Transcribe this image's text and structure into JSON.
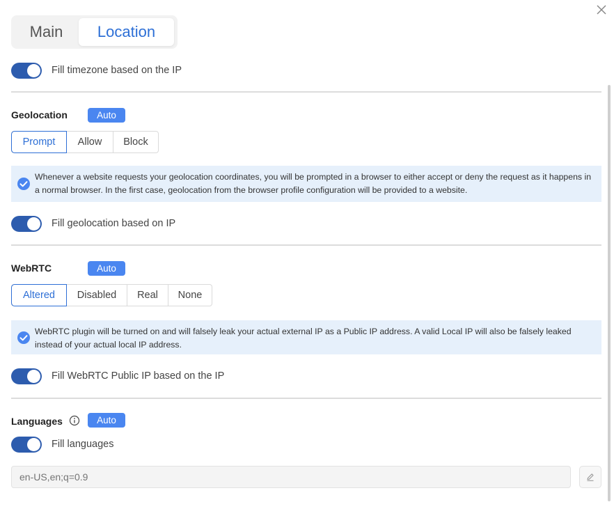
{
  "tabs": [
    {
      "label": "Main",
      "active": false
    },
    {
      "label": "Location",
      "active": true
    }
  ],
  "timezone": {
    "label": "Fill timezone based on the IP",
    "enabled": true
  },
  "geolocation": {
    "title": "Geolocation",
    "badge": "Auto",
    "options": [
      "Prompt",
      "Allow",
      "Block"
    ],
    "selected": "Prompt",
    "info": "Whenever a website requests your geolocation coordinates, you will be prompted in a browser to either accept or deny the request as it happens in a normal browser. In the first case, geolocation from the browser profile configuration will be provided to a website.",
    "toggle_label": "Fill geolocation based on IP",
    "toggle_enabled": true
  },
  "webrtc": {
    "title": "WebRTC",
    "badge": "Auto",
    "options": [
      "Altered",
      "Disabled",
      "Real",
      "None"
    ],
    "selected": "Altered",
    "info": "WebRTC plugin will be turned on and will falsely leak your actual external IP as a Public IP address. A valid Local IP will also be falsely leaked instead of your actual local IP address.",
    "toggle_label": "Fill WebRTC Public IP based on the IP",
    "toggle_enabled": true
  },
  "languages": {
    "title": "Languages",
    "badge": "Auto",
    "toggle_label": "Fill languages",
    "toggle_enabled": true,
    "input_placeholder": "en-US,en;q=0.9",
    "input_value": ""
  },
  "icons": {
    "close": "close-icon",
    "check": "check-circle-icon",
    "info": "info-icon",
    "edit": "pencil-icon"
  },
  "colors": {
    "accent": "#2d6fd6",
    "toggle": "#2d5cae",
    "badge": "#4a86f0",
    "info_bg": "#e6f0fb"
  }
}
